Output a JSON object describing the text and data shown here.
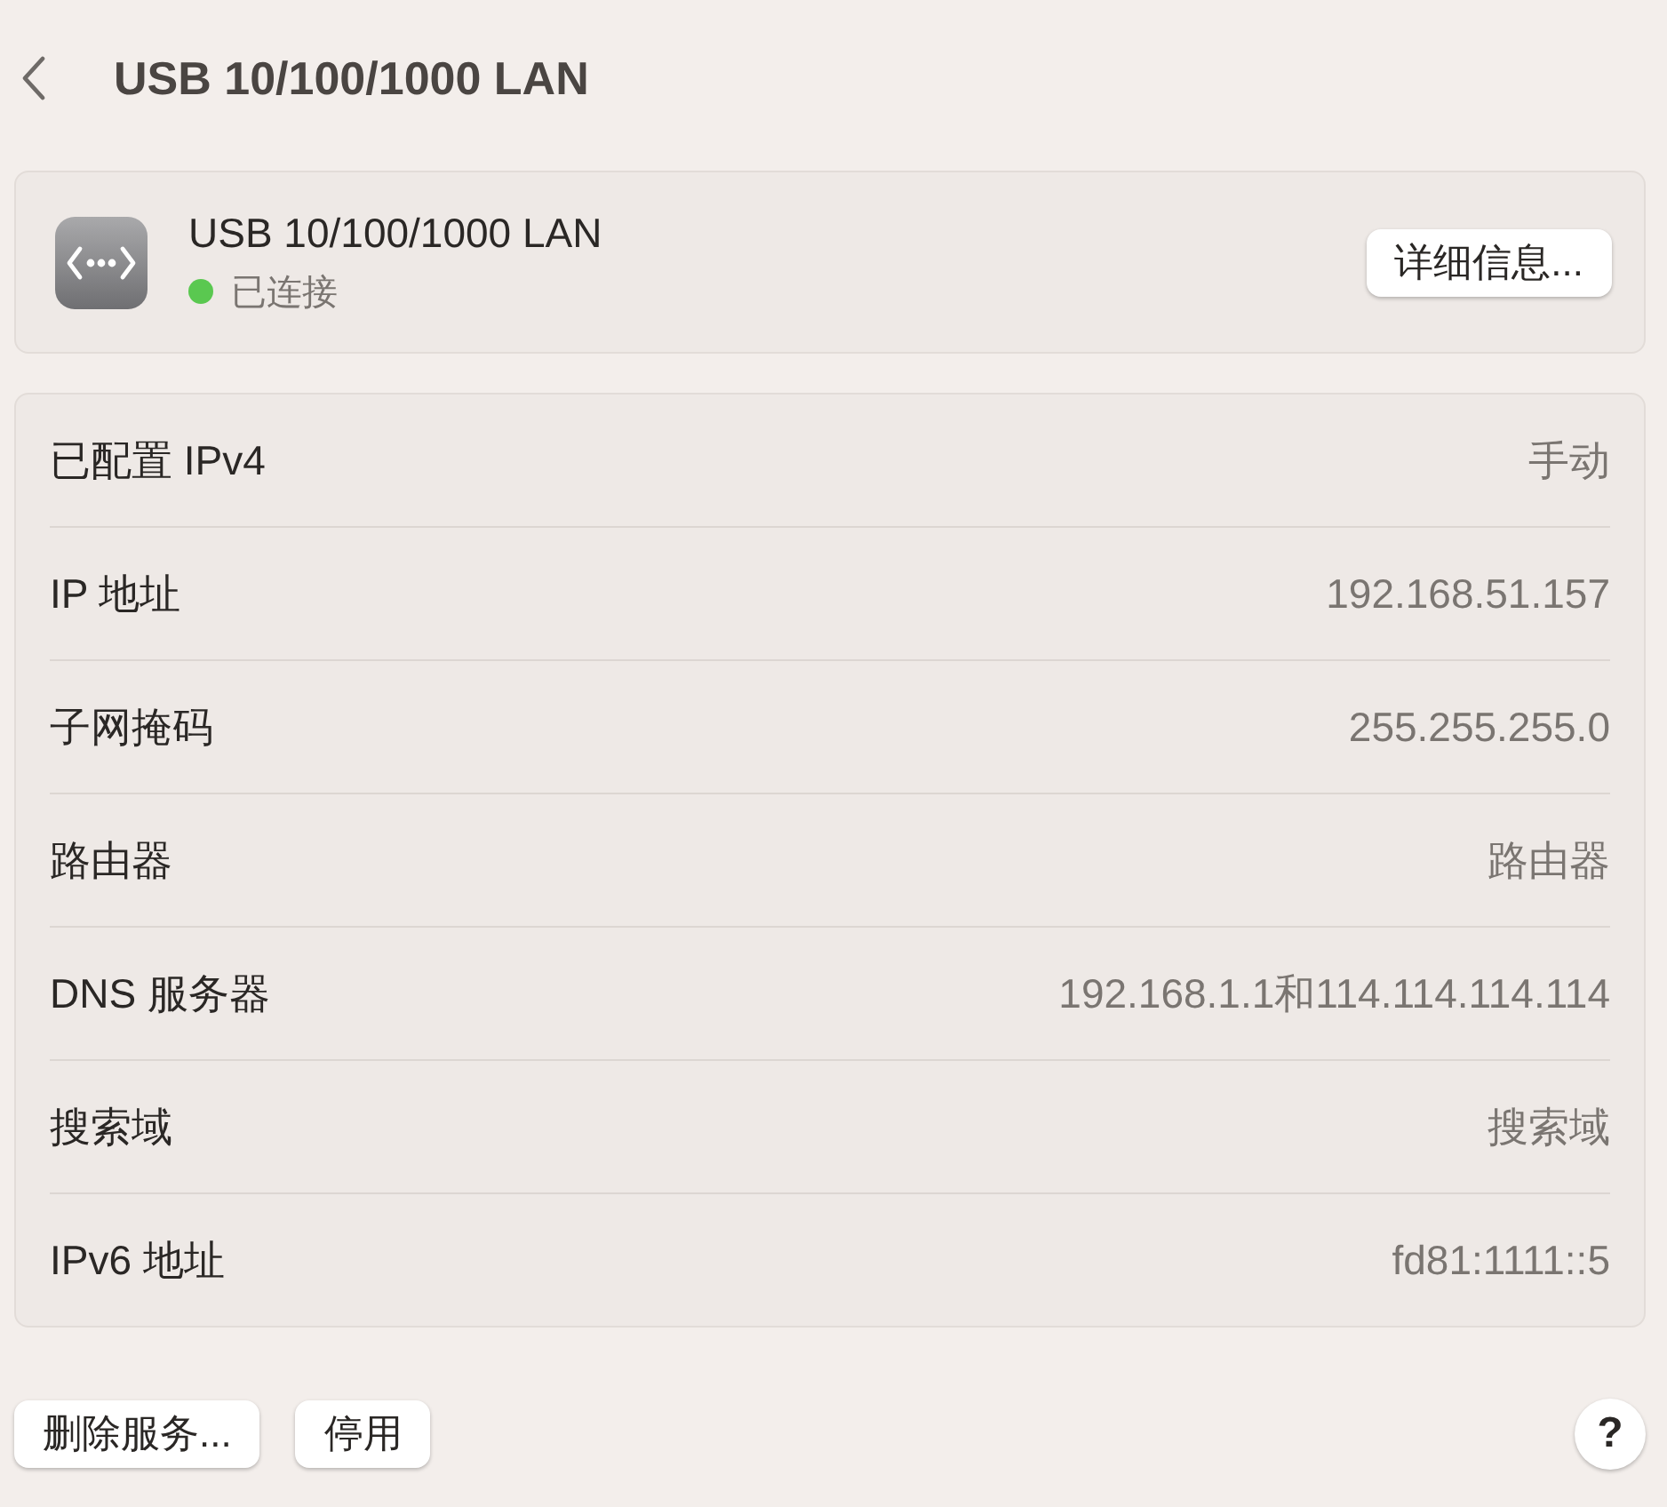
{
  "header": {
    "title": "USB 10/100/1000 LAN"
  },
  "service": {
    "name": "USB 10/100/1000 LAN",
    "status": "已连接",
    "color": "#5ac850",
    "details_button": "详细信息..."
  },
  "rows": [
    {
      "label": "已配置 IPv4",
      "value": "手动"
    },
    {
      "label": "IP 地址",
      "value": "192.168.51.157"
    },
    {
      "label": "子网掩码",
      "value": "255.255.255.0"
    },
    {
      "label": "路由器",
      "value": "路由器"
    },
    {
      "label": "DNS 服务器",
      "value": "192.168.1.1和114.114.114.114"
    },
    {
      "label": "搜索域",
      "value": "搜索域"
    },
    {
      "label": "IPv6 地址",
      "value": "fd81:1111::5"
    }
  ],
  "buttons": [
    "删除服务...",
    "停用"
  ],
  "help": "?"
}
